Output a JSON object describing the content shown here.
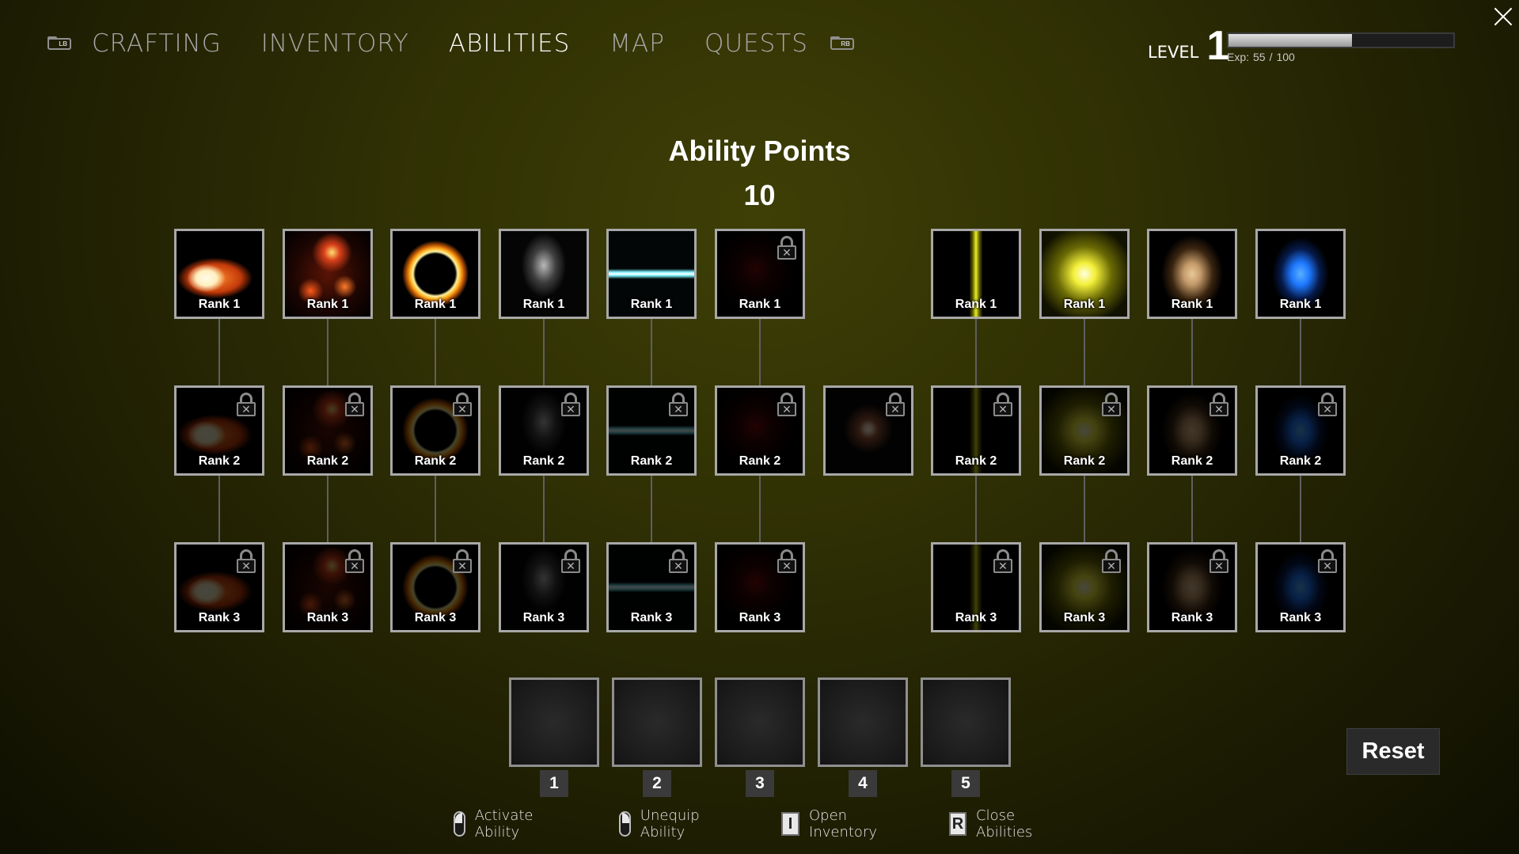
{
  "nav": {
    "lb_hint": "LB",
    "rb_hint": "RB",
    "tabs": [
      {
        "label": "CRAFTING",
        "active": false
      },
      {
        "label": "INVENTORY",
        "active": false
      },
      {
        "label": "ABILITIES",
        "active": true
      },
      {
        "label": "MAP",
        "active": false
      },
      {
        "label": "QUESTS",
        "active": false
      }
    ]
  },
  "level": {
    "label": "LEVEL",
    "value": "1",
    "exp_prefix": "Exp:",
    "exp_current": "55",
    "exp_sep": "/",
    "exp_max": "100",
    "exp_fraction": 0.55
  },
  "ability_points": {
    "title": "Ability Points",
    "value": "10"
  },
  "columns": [
    {
      "name": "fireball",
      "icon": "fireball-icon",
      "color": "#ff8a2a",
      "ranks": [
        {
          "label": "Rank 1",
          "locked": false
        },
        {
          "label": "Rank 2",
          "locked": true
        },
        {
          "label": "Rank 3",
          "locked": true
        }
      ]
    },
    {
      "name": "embers",
      "icon": "ember-burst-icon",
      "color": "#d9401a",
      "ranks": [
        {
          "label": "Rank 1",
          "locked": false
        },
        {
          "label": "Rank 2",
          "locked": true
        },
        {
          "label": "Rank 3",
          "locked": true
        }
      ]
    },
    {
      "name": "fire-ring",
      "icon": "fire-ring-icon",
      "color": "#ffb020",
      "ranks": [
        {
          "label": "Rank 1",
          "locked": false
        },
        {
          "label": "Rank 2",
          "locked": true
        },
        {
          "label": "Rank 3",
          "locked": true
        }
      ]
    },
    {
      "name": "tornado",
      "icon": "tornado-icon",
      "color": "#d8d8d8",
      "ranks": [
        {
          "label": "Rank 1",
          "locked": false
        },
        {
          "label": "Rank 2",
          "locked": true
        },
        {
          "label": "Rank 3",
          "locked": true
        }
      ]
    },
    {
      "name": "lightning",
      "icon": "lightning-wave-icon",
      "color": "#7ff3ff",
      "ranks": [
        {
          "label": "Rank 1",
          "locked": false
        },
        {
          "label": "Rank 2",
          "locked": true
        },
        {
          "label": "Rank 3",
          "locked": true
        }
      ]
    },
    {
      "name": "dark-glow",
      "icon": "red-glow-icon",
      "color": "#7a0a0a",
      "ranks": [
        {
          "label": "Rank 1",
          "locked": true
        },
        {
          "label": "Rank 2",
          "locked": true
        },
        {
          "label": "Rank 3",
          "locked": true
        }
      ]
    },
    {
      "name": "star-flash",
      "icon": "star-flash-icon",
      "color": "#ffdcc0",
      "ranks": [
        null,
        {
          "label": "",
          "locked": true
        },
        null
      ]
    },
    {
      "name": "light-beam",
      "icon": "light-beam-icon",
      "color": "#e8f020",
      "ranks": [
        {
          "label": "Rank 1",
          "locked": false
        },
        {
          "label": "Rank 2",
          "locked": true
        },
        {
          "label": "Rank 3",
          "locked": true
        }
      ]
    },
    {
      "name": "holy-burst",
      "icon": "yellow-burst-icon",
      "color": "#f4f03a",
      "ranks": [
        {
          "label": "Rank 1",
          "locked": false
        },
        {
          "label": "Rank 2",
          "locked": true
        },
        {
          "label": "Rank 3",
          "locked": true
        }
      ]
    },
    {
      "name": "dust-orb",
      "icon": "dust-orb-icon",
      "color": "#c49a6a",
      "ranks": [
        {
          "label": "Rank 1",
          "locked": false
        },
        {
          "label": "Rank 2",
          "locked": true
        },
        {
          "label": "Rank 3",
          "locked": true
        }
      ]
    },
    {
      "name": "blue-orb",
      "icon": "blue-orb-icon",
      "color": "#1e78ff",
      "ranks": [
        {
          "label": "Rank 1",
          "locked": false
        },
        {
          "label": "Rank 2",
          "locked": true
        },
        {
          "label": "Rank 3",
          "locked": true
        }
      ]
    }
  ],
  "hotbar": {
    "slots": [
      "1",
      "2",
      "3",
      "4",
      "5"
    ]
  },
  "reset_label": "Reset",
  "hints": [
    {
      "icon": "mouse-left-icon",
      "label": "Activate Ability"
    },
    {
      "icon": "mouse-right-icon",
      "label": "Unequip Ability"
    },
    {
      "icon": "key-i-icon",
      "key": "I",
      "label": "Open Inventory"
    },
    {
      "icon": "key-r-icon",
      "key": "R",
      "label": "Close Abilities"
    }
  ],
  "lock_mark": "✕"
}
